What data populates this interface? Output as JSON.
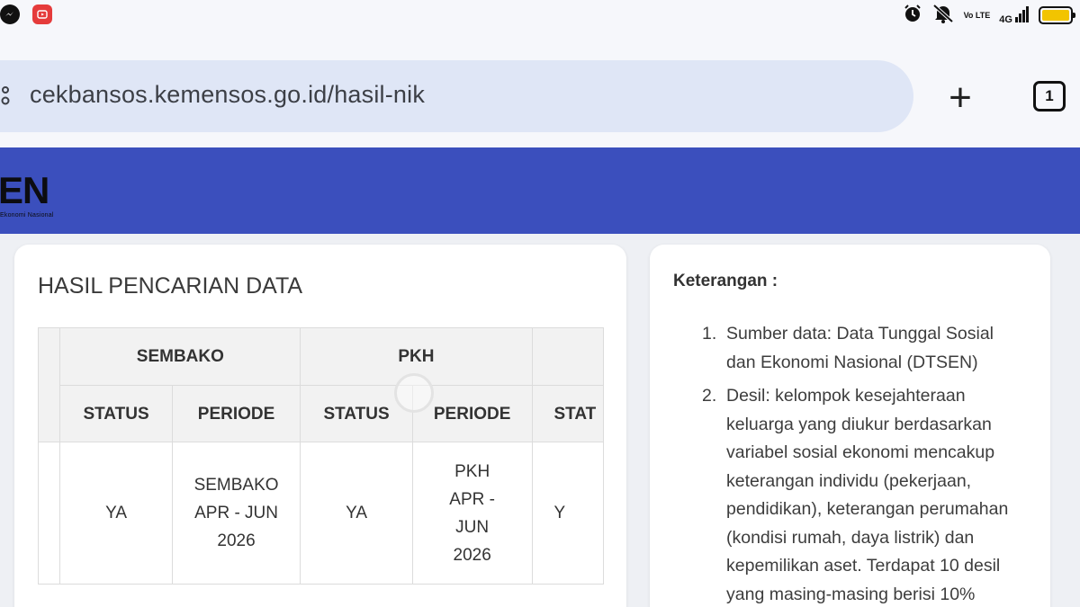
{
  "status_bar": {
    "left_apps": [
      "messenger-icon",
      "youtube-icon"
    ],
    "right_icons": [
      "alarm-icon",
      "mute-icon",
      "volte-icon",
      "signal-icon",
      "battery-icon"
    ],
    "volte_text": "Vo LTE",
    "signal_text": "4G",
    "battery_color": "#f2c400"
  },
  "browser": {
    "url": "cekbansos.kemensos.go.id/hasil-nik",
    "new_tab_label": "+",
    "tab_count": "1"
  },
  "site_header": {
    "logo_text": "EN",
    "logo_subtext": "Ekonomi Nasional",
    "background": "#3b4fbd"
  },
  "main": {
    "title": "HASIL PENCARIAN DATA",
    "table": {
      "groups": [
        "SEMBAKO",
        "PKH"
      ],
      "columns": [
        "STATUS",
        "PERIODE",
        "STATUS",
        "PERIODE",
        "STAT"
      ],
      "row": {
        "sembako_status": "YA",
        "sembako_periode": [
          "SEMBAKO",
          "APR - JUN",
          "2026"
        ],
        "pkh_status": "YA",
        "pkh_periode": [
          "PKH",
          "APR -",
          "JUN",
          "2026"
        ],
        "next_status": "Y"
      }
    }
  },
  "side": {
    "title": "Keterangan :",
    "items": [
      {
        "num": "1.",
        "text": "Sumber data: Data Tunggal Sosial dan Ekonomi Nasional (DTSEN)"
      },
      {
        "num": "2.",
        "text": "Desil: kelompok kesejahteraan keluarga yang diukur berdasarkan variabel sosial ekonomi mencakup keterangan individu (pekerjaan, pendidikan), keterangan perumahan (kondisi rumah, daya listrik) dan kepemilikan aset. Terdapat 10 desil yang masing-masing berisi 10%"
      }
    ]
  }
}
